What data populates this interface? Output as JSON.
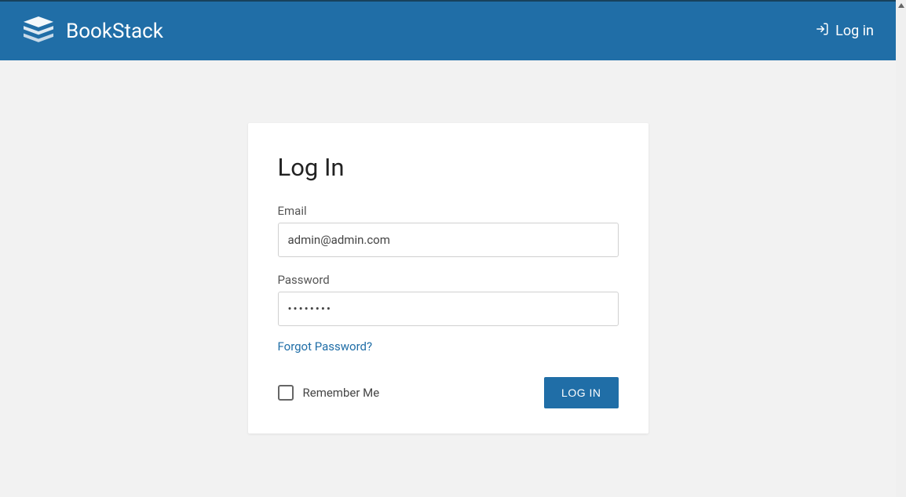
{
  "header": {
    "app_name": "BookStack",
    "login_link": "Log in"
  },
  "login_form": {
    "title": "Log In",
    "email_label": "Email",
    "email_value": "admin@admin.com",
    "password_label": "Password",
    "password_value": "••••••••",
    "forgot_link": "Forgot Password?",
    "remember_label": "Remember Me",
    "submit_label": "LOG IN"
  },
  "colors": {
    "primary": "#206ea7",
    "background": "#f2f2f2"
  }
}
